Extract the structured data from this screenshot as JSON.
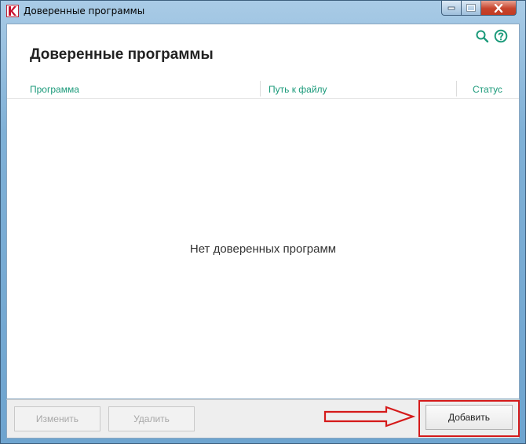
{
  "window": {
    "title": "Доверенные программы"
  },
  "header": {
    "heading": "Доверенные программы",
    "icons": [
      "search-icon",
      "help-icon"
    ]
  },
  "table": {
    "columns": [
      "Программа",
      "Путь к файлу",
      "Статус"
    ],
    "empty_message": "Нет доверенных программ"
  },
  "footer": {
    "edit_label": "Изменить",
    "delete_label": "Удалить",
    "add_label": "Добавить"
  },
  "colors": {
    "accent": "#1b9a7a",
    "annotation": "#d51a1a"
  }
}
